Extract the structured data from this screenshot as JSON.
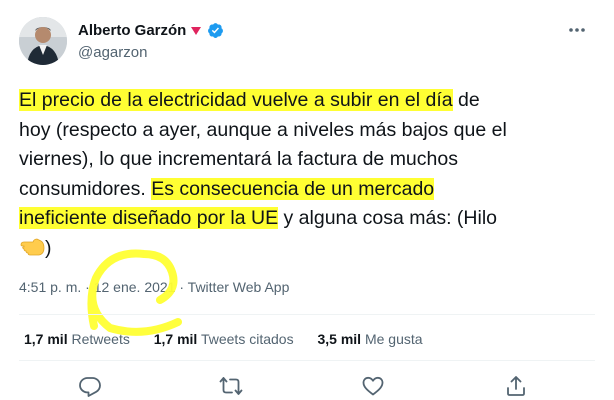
{
  "author": {
    "name": "Alberto Garzón",
    "handle": "@agarzon"
  },
  "tweet": {
    "lines": [
      {
        "highlight": "El precio de la electricidad vuelve a subir en el día",
        "rest": " de"
      },
      {
        "text": "hoy (respecto a ayer, aunque a niveles más bajos que el"
      },
      {
        "text": "viernes), lo que incrementará la factura de muchos"
      },
      {
        "plain": "consumidores. ",
        "highlight": "Es consecuencia de un mercado"
      },
      {
        "highlight": "ineficiente diseñado por la UE",
        "rest": " y alguna cosa más: (Hilo"
      },
      {
        "text": ")"
      }
    ]
  },
  "meta": {
    "time": "4:51 p. m.",
    "sep1": " · ",
    "date": "12 ene. 2021",
    "sep2": " · ",
    "source": "Twitter Web App"
  },
  "stats": {
    "retweets_count": "1,7 mil",
    "retweets_label": "Retweets",
    "quotes_count": "1,7 mil",
    "quotes_label": "Tweets citados",
    "likes_count": "3,5 mil",
    "likes_label": "Me gusta"
  },
  "icons": {
    "more": "more-icon",
    "verified": "verified-badge-icon",
    "emoji": "backhand-index-pointing-left-icon",
    "reply": "reply-icon",
    "retweet": "retweet-icon",
    "like": "like-icon",
    "share": "share-icon"
  },
  "colors": {
    "highlight": "#ffff33",
    "verified": "#1d9bf0",
    "muted": "#536471",
    "name_triangle": "#e0245e"
  }
}
